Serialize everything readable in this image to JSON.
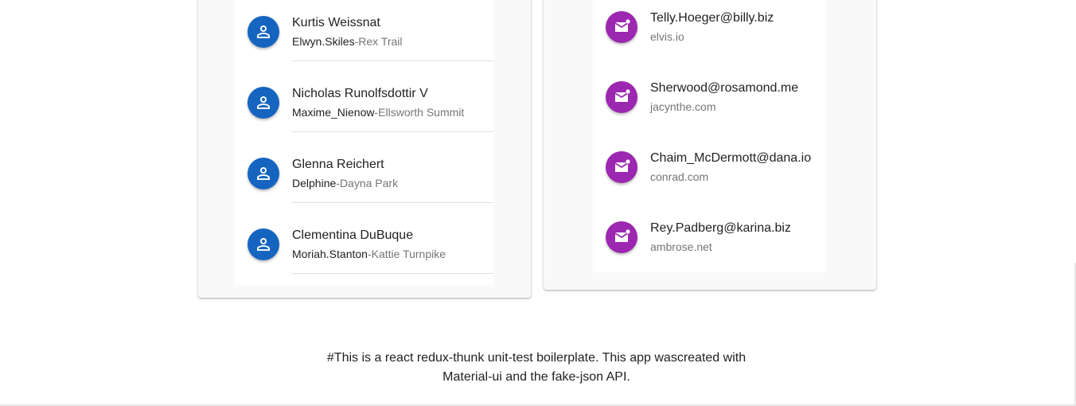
{
  "colors": {
    "user_avatar": "#1565c0",
    "email_avatar": "#9c27b0"
  },
  "users": [
    {
      "name": "Kurtis Weissnat",
      "username": "Elwyn.Skiles",
      "separator": "-",
      "street": "Rex Trail",
      "icon": "person-icon"
    },
    {
      "name": "Nicholas Runolfsdottir V",
      "username": "Maxime_Nienow",
      "separator": "-",
      "street": "Ellsworth Summit",
      "icon": "person-icon"
    },
    {
      "name": "Glenna Reichert",
      "username": "Delphine",
      "separator": "-",
      "street": "Dayna Park",
      "icon": "person-icon"
    },
    {
      "name": "Clementina DuBuque",
      "username": "Moriah.Stanton",
      "separator": "-",
      "street": "Kattie Turnpike",
      "icon": "person-icon"
    }
  ],
  "emails": [
    {
      "email": "Telly.Hoeger@billy.biz",
      "website": "elvis.io",
      "icon": "mail-icon"
    },
    {
      "email": "Sherwood@rosamond.me",
      "website": "jacynthe.com",
      "icon": "mail-icon"
    },
    {
      "email": "Chaim_McDermott@dana.io",
      "website": "conrad.com",
      "icon": "mail-icon"
    },
    {
      "email": "Rey.Padberg@karina.biz",
      "website": "ambrose.net",
      "icon": "mail-icon"
    }
  ],
  "footer": {
    "line1": "#This is a react redux-thunk unit-test boilerplate. This app wascreated with",
    "line2": "Material-ui and the fake-json API."
  }
}
